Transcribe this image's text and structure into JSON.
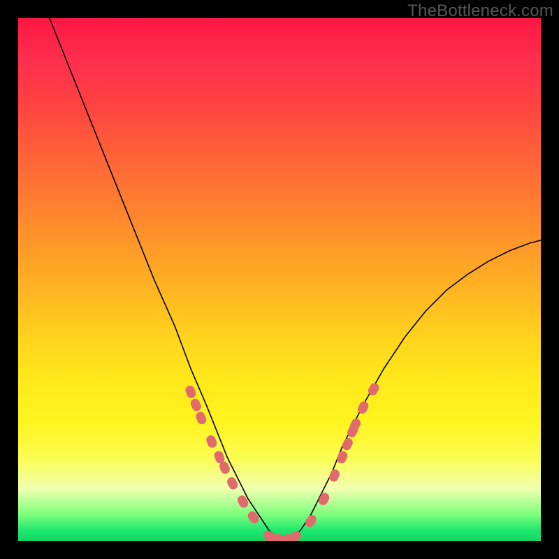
{
  "watermark": "TheBottleneck.com",
  "chart_data": {
    "type": "line",
    "title": "",
    "xlabel": "",
    "ylabel": "",
    "xlim": [
      0,
      100
    ],
    "ylim": [
      0,
      100
    ],
    "series": [
      {
        "name": "curve",
        "x": [
          6,
          10,
          14,
          18,
          22,
          26,
          30,
          33,
          36,
          38,
          40,
          42,
          44,
          46,
          48,
          50,
          52,
          54,
          56,
          58,
          60,
          62,
          66,
          70,
          74,
          78,
          82,
          86,
          90,
          94,
          98,
          100
        ],
        "y": [
          100,
          90,
          80,
          70,
          60,
          50,
          41,
          33,
          26,
          21,
          16,
          12,
          8,
          5,
          2,
          0,
          0,
          2,
          5,
          9,
          13,
          18,
          26,
          33,
          39,
          44,
          48,
          51,
          53.5,
          55.5,
          57,
          57.5
        ]
      }
    ],
    "markers": {
      "name": "data-points",
      "color": "#e06a6c",
      "points": [
        {
          "x": 33,
          "y": 28.5
        },
        {
          "x": 34,
          "y": 26
        },
        {
          "x": 35,
          "y": 23.5
        },
        {
          "x": 37,
          "y": 19
        },
        {
          "x": 38.5,
          "y": 16
        },
        {
          "x": 39.5,
          "y": 14
        },
        {
          "x": 41,
          "y": 11
        },
        {
          "x": 43,
          "y": 7.5
        },
        {
          "x": 45,
          "y": 4.5
        },
        {
          "x": 48,
          "y": 0.8
        },
        {
          "x": 49,
          "y": 0.4
        },
        {
          "x": 50,
          "y": 0.2
        },
        {
          "x": 51,
          "y": 0.2
        },
        {
          "x": 52,
          "y": 0.4
        },
        {
          "x": 53,
          "y": 0.8
        },
        {
          "x": 56,
          "y": 3.8
        },
        {
          "x": 58.5,
          "y": 8
        },
        {
          "x": 60.5,
          "y": 12.5
        },
        {
          "x": 62,
          "y": 16
        },
        {
          "x": 63,
          "y": 18.5
        },
        {
          "x": 64,
          "y": 21
        },
        {
          "x": 64.5,
          "y": 22.2
        },
        {
          "x": 66,
          "y": 25.5
        },
        {
          "x": 68,
          "y": 29
        }
      ]
    }
  }
}
